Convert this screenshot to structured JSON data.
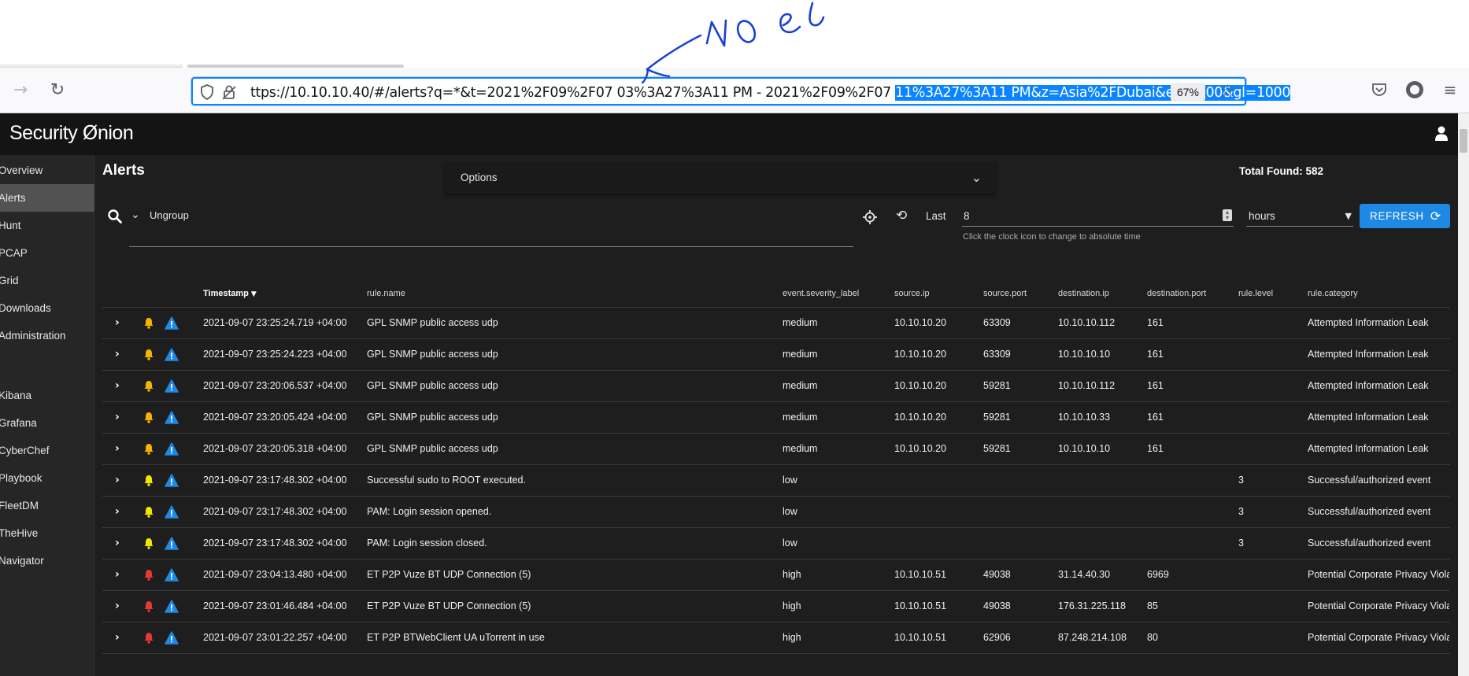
{
  "browser": {
    "url_prefix": "ttps://10.10.10.40/#/alerts?q=*&t=2021%2F09%2F07 03%3A27%3A11 PM - 2021%2F09%2F07 ",
    "url_selected": "11%3A27%3A11 PM&z=Asia%2FDubai&el=1000&gl=1000",
    "zoom": "67%",
    "icons": [
      "back-arrow-icon",
      "reload-icon",
      "shield-icon",
      "lock-icon",
      "star-icon",
      "pocket-icon",
      "account-icon",
      "hamburger-menu-icon"
    ]
  },
  "app": {
    "logo_left": "Security ",
    "logo_o": "Ø",
    "logo_right": "nion",
    "accent": "#1e88e5",
    "sidebar": {
      "items": [
        "Overview",
        "Alerts",
        "Hunt",
        "PCAP",
        "Grid",
        "Downloads",
        "Administration"
      ],
      "tools": [
        "Kibana",
        "Grafana",
        "CyberChef",
        "Playbook",
        "FleetDM",
        "TheHive",
        "Navigator"
      ],
      "active": "Alerts"
    },
    "title": "Alerts",
    "options_label": "Options",
    "total_found": "Total Found: 582",
    "group_label": "Ungroup",
    "time": {
      "last_label": "Last",
      "value": "8",
      "unit": "hours",
      "hint": "Click the clock icon to change to absolute time",
      "refresh_label": "REFRESH"
    },
    "table": {
      "headers": [
        "Timestamp",
        "rule.name",
        "event.severity_label",
        "source.ip",
        "source.port",
        "destination.ip",
        "destination.port",
        "rule.level",
        "rule.category"
      ],
      "rows": [
        {
          "bell": "#f5b400",
          "timestamp": "2021-09-07 23:25:24.719 +04:00",
          "rule_name": "GPL SNMP public access udp",
          "severity": "medium",
          "src_ip": "10.10.10.20",
          "src_port": "63309",
          "dst_ip": "10.10.10.112",
          "dst_port": "161",
          "level": "",
          "category": "Attempted Information Leak"
        },
        {
          "bell": "#f5b400",
          "timestamp": "2021-09-07 23:25:24.223 +04:00",
          "rule_name": "GPL SNMP public access udp",
          "severity": "medium",
          "src_ip": "10.10.10.20",
          "src_port": "63309",
          "dst_ip": "10.10.10.10",
          "dst_port": "161",
          "level": "",
          "category": "Attempted Information Leak"
        },
        {
          "bell": "#f5b400",
          "timestamp": "2021-09-07 23:20:06.537 +04:00",
          "rule_name": "GPL SNMP public access udp",
          "severity": "medium",
          "src_ip": "10.10.10.20",
          "src_port": "59281",
          "dst_ip": "10.10.10.112",
          "dst_port": "161",
          "level": "",
          "category": "Attempted Information Leak"
        },
        {
          "bell": "#f5b400",
          "timestamp": "2021-09-07 23:20:05.424 +04:00",
          "rule_name": "GPL SNMP public access udp",
          "severity": "medium",
          "src_ip": "10.10.10.20",
          "src_port": "59281",
          "dst_ip": "10.10.10.33",
          "dst_port": "161",
          "level": "",
          "category": "Attempted Information Leak"
        },
        {
          "bell": "#f5b400",
          "timestamp": "2021-09-07 23:20:05.318 +04:00",
          "rule_name": "GPL SNMP public access udp",
          "severity": "medium",
          "src_ip": "10.10.10.20",
          "src_port": "59281",
          "dst_ip": "10.10.10.10",
          "dst_port": "161",
          "level": "",
          "category": "Attempted Information Leak"
        },
        {
          "bell": "#f2e600",
          "timestamp": "2021-09-07 23:17:48.302 +04:00",
          "rule_name": "Successful sudo to ROOT executed.",
          "severity": "low",
          "src_ip": "",
          "src_port": "",
          "dst_ip": "",
          "dst_port": "",
          "level": "3",
          "category": "Successful/authorized event"
        },
        {
          "bell": "#f2e600",
          "timestamp": "2021-09-07 23:17:48.302 +04:00",
          "rule_name": "PAM: Login session opened.",
          "severity": "low",
          "src_ip": "",
          "src_port": "",
          "dst_ip": "",
          "dst_port": "",
          "level": "3",
          "category": "Successful/authorized event"
        },
        {
          "bell": "#f2e600",
          "timestamp": "2021-09-07 23:17:48.302 +04:00",
          "rule_name": "PAM: Login session closed.",
          "severity": "low",
          "src_ip": "",
          "src_port": "",
          "dst_ip": "",
          "dst_port": "",
          "level": "3",
          "category": "Successful/authorized event"
        },
        {
          "bell": "#e53935",
          "timestamp": "2021-09-07 23:04:13.480 +04:00",
          "rule_name": "ET P2P Vuze BT UDP Connection (5)",
          "severity": "high",
          "src_ip": "10.10.10.51",
          "src_port": "49038",
          "dst_ip": "31.14.40.30",
          "dst_port": "6969",
          "level": "",
          "category": "Potential Corporate Privacy Violat"
        },
        {
          "bell": "#e53935",
          "timestamp": "2021-09-07 23:01:46.484 +04:00",
          "rule_name": "ET P2P Vuze BT UDP Connection (5)",
          "severity": "high",
          "src_ip": "10.10.10.51",
          "src_port": "49038",
          "dst_ip": "176.31.225.118",
          "dst_port": "85",
          "level": "",
          "category": "Potential Corporate Privacy Violat"
        },
        {
          "bell": "#e53935",
          "timestamp": "2021-09-07 23:01:22.257 +04:00",
          "rule_name": "ET P2P BTWebClient UA uTorrent in use",
          "severity": "high",
          "src_ip": "10.10.10.51",
          "src_port": "62906",
          "dst_ip": "87.248.214.108",
          "dst_port": "80",
          "level": "",
          "category": "Potential Corporate Privacy Violat"
        }
      ]
    }
  }
}
